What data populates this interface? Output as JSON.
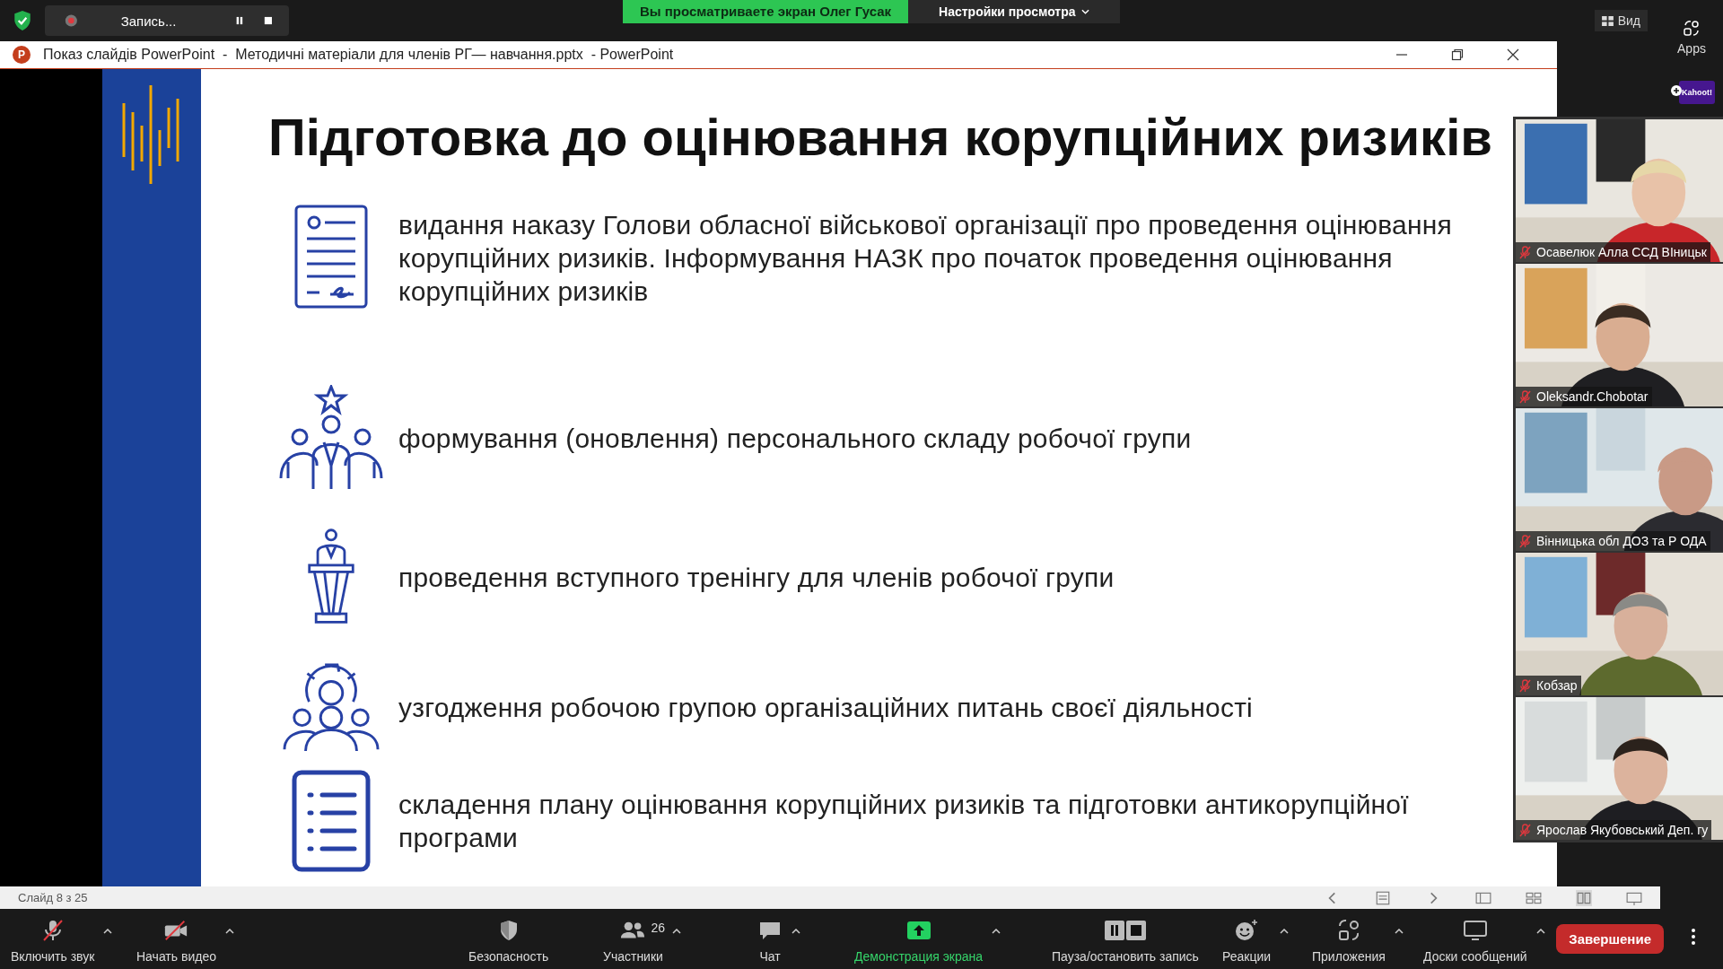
{
  "top_bar": {
    "recording": {
      "label": "Запись..."
    },
    "sharing_banner": "Вы просматриваете экран Олег Гусак",
    "view_options": "Настройки просмотра",
    "view_button": "Вид"
  },
  "side_rail": {
    "apps_label": "Apps",
    "kahoot_label": "Kahoot!"
  },
  "window": {
    "app_icon_letter": "P",
    "title": "Показ слайдів PowerPoint  -  Методичні матеріали для членів РГ— навчання.pptx  - PowerPoint"
  },
  "slide": {
    "title": "Підготовка до оцінювання корупційних ризиків",
    "items": [
      {
        "kind": "document",
        "text": "видання наказу Голови обласної військової організації про проведення оцінювання корупційних ризиків. Інформування НАЗК про початок проведення оцінювання корупційних ризиків"
      },
      {
        "kind": "team",
        "text": "формування (оновлення) персонального складу робочої групи"
      },
      {
        "kind": "speaker",
        "text": "проведення вступного тренінгу для членів робочої групи"
      },
      {
        "kind": "gear_people",
        "text": "узгодження робочою групою організаційних питань своєї діяльності"
      },
      {
        "kind": "checklist",
        "text": "складення плану оцінювання корупційних ризиків та підготовки антикорупційної програми"
      }
    ]
  },
  "status_bar": {
    "slide_counter": "Слайд 8 з 25"
  },
  "participants": [
    {
      "name": "Осавелюк Алла ССД ВІницьк",
      "muted": true,
      "kind": "picture"
    },
    {
      "name": "Oleksandr.Chobotar",
      "muted": true,
      "kind": "picture"
    },
    {
      "name": "Вінницька обл ДОЗ та Р ОДА",
      "muted": true,
      "kind": "picture"
    },
    {
      "name": "Кобзар",
      "muted": true,
      "kind": "picture"
    },
    {
      "name": "Ярослав Якубовський Деп. гу",
      "muted": true,
      "kind": "picture"
    }
  ],
  "toolbar": {
    "items": [
      {
        "kind": "mic",
        "label": "Включить звук",
        "off": true,
        "caret": true,
        "active": false
      },
      {
        "kind": "video",
        "label": "Начать видео",
        "off": true,
        "caret": true,
        "active": false
      },
      {
        "kind": "security",
        "label": "Безопасность",
        "caret": false,
        "active": false
      },
      {
        "kind": "participants",
        "label": "Участники",
        "count": "26",
        "caret": true,
        "active": false
      },
      {
        "kind": "chat",
        "label": "Чат",
        "caret": true,
        "active": false
      },
      {
        "kind": "share",
        "label": "Демонстрация экрана",
        "caret": true,
        "active": true
      },
      {
        "kind": "record",
        "label": "Пауза/остановить запись",
        "caret": false,
        "active": false
      },
      {
        "kind": "reactions",
        "label": "Реакции",
        "caret": true,
        "active": false
      },
      {
        "kind": "apps",
        "label": "Приложения",
        "caret": true,
        "active": false
      },
      {
        "kind": "whiteboards",
        "label": "Доски сообщений",
        "caret": true,
        "active": false
      }
    ],
    "end_button": "Завершение"
  }
}
